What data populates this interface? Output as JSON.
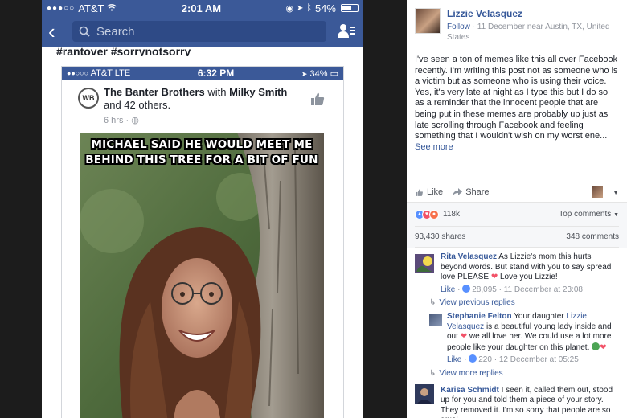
{
  "phone": {
    "carrier": "AT&T",
    "time": "2:01 AM",
    "battery": "54%",
    "search_placeholder": "Search",
    "hashtags": "#rantover #sorrynotsorry"
  },
  "shared": {
    "carrier": "AT&T  LTE",
    "time": "6:32 PM",
    "battery": "34%",
    "page_name": "The Banter Brothers",
    "with_text": "with",
    "tagged": "Milky Smith",
    "others": "and 42 others.",
    "time_ago": "6 hrs",
    "logo": "WB",
    "meme_line1": "MICHAEL SAID HE WOULD MEET ME",
    "meme_line2": "BEHIND THIS TREE FOR A BIT OF FUN"
  },
  "post": {
    "author": "Lizzie Velasquez",
    "follow": "Follow",
    "meta": "11 December near Austin, TX, United States",
    "body": "I've seen a ton of memes like this all over Facebook recently. I'm writing this post not as someone who is a victim but as someone who is using their voice. Yes, it's very late at night as I type this but I do so as a reminder that the innocent people that are being put in these memes are probably up just as late scrolling through Facebook and feeling something that I wouldn't wish on my worst ene...",
    "see_more": "See more",
    "like_label": "Like",
    "share_label": "Share",
    "reaction_count": "118k",
    "top_comments": "Top comments",
    "shares": "93,430 shares",
    "comments_count": "348 comments"
  },
  "comments": [
    {
      "name": "Rita Velasquez",
      "text": "As Lizzie's mom this hurts beyond words. But stand with you to say spread love PLEASE",
      "text_end": "Love you Lizzie!",
      "like": "Like",
      "likes": "28,095",
      "date": "11 December at 23:08"
    },
    {
      "name": "Karisa Schmidt",
      "text": "I seen it, called them out, stood up for you and told them a piece of your story. They removed it. I'm so sorry that people are so cruel"
    }
  ],
  "view_previous": "View previous replies",
  "reply": {
    "name": "Stephanie Felton",
    "text_start": "Your daughter",
    "mention": "Lizzie Velasquez",
    "text_mid": "is a beautiful young lady inside and out",
    "text_mid2": "we all love her. We could use a lot more people like your daughter on this planet.",
    "like": "Like",
    "likes": "220",
    "date": "12 December at 05:25"
  },
  "view_more": "View more replies",
  "colors": {
    "facebook_blue": "#3b5998",
    "link_blue": "#365899",
    "love_red": "#f25268"
  }
}
